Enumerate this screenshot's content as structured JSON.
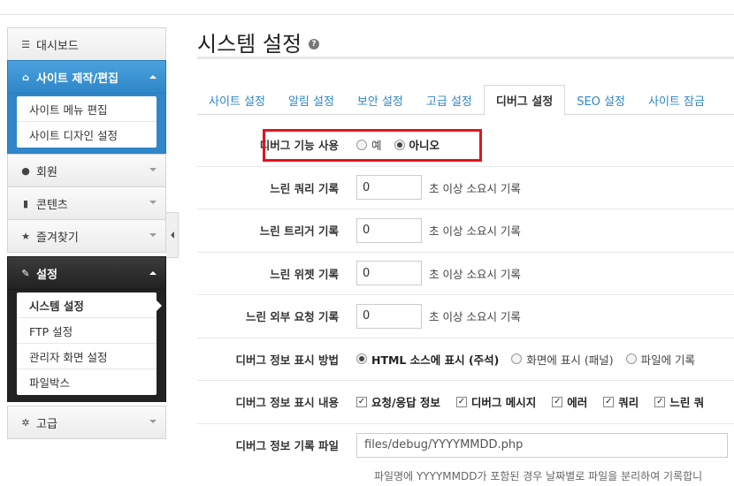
{
  "sidebar": {
    "dashboard": "대시보드",
    "site_build": "사이트 제작/편집",
    "site_build_items": [
      "사이트 메뉴 편집",
      "사이트 디자인 설정"
    ],
    "member": "회원",
    "content": "콘텐츠",
    "favorites": "즐겨찾기",
    "settings": "설정",
    "settings_items": [
      "시스템 설정",
      "FTP 설정",
      "관리자 화면 설정",
      "파일박스"
    ],
    "advanced": "고급"
  },
  "page": {
    "title": "시스템 설정",
    "help_glyph": "?"
  },
  "tabs": [
    "사이트 설정",
    "알림 설정",
    "보안 설정",
    "고급 설정",
    "디버그 설정",
    "SEO 설정",
    "사이트 잠금"
  ],
  "active_tab": "디버그 설정",
  "form": {
    "debug_enable": {
      "label": "디버그 기능 사용",
      "options": [
        "예",
        "아니오"
      ],
      "selected": "아니오"
    },
    "slow_query": {
      "label": "느린 쿼리 기록",
      "value": "0",
      "suffix": "초 이상 소요시 기록"
    },
    "slow_trigger": {
      "label": "느린 트리거 기록",
      "value": "0",
      "suffix": "초 이상 소요시 기록"
    },
    "slow_widget": {
      "label": "느린 위젯 기록",
      "value": "0",
      "suffix": "초 이상 소요시 기록"
    },
    "slow_remote": {
      "label": "느린 외부 요청 기록",
      "value": "0",
      "suffix": "초 이상 소요시 기록"
    },
    "display_method": {
      "label": "디버그 정보 표시 방법",
      "options": [
        "HTML 소스에 표시 (주석)",
        "화면에 표시 (패널)",
        "파일에 기록"
      ],
      "selected": "HTML 소스에 표시 (주석)"
    },
    "display_content": {
      "label": "디버그 정보 표시 내용",
      "options": [
        "요청/응답 정보",
        "디버그 메시지",
        "에러",
        "쿼리",
        "느린 쿼"
      ]
    },
    "log_file": {
      "label": "디버그 정보 기록 파일",
      "value": "files/debug/YYYYMMDD.php",
      "hint": "파일명에 YYYYMMDD가 포함된 경우 날짜별로 파일을 분리하여 기록합니"
    }
  },
  "colors": {
    "accent": "#2f86c8",
    "highlight": "#e3141d",
    "dark": "#222222"
  }
}
